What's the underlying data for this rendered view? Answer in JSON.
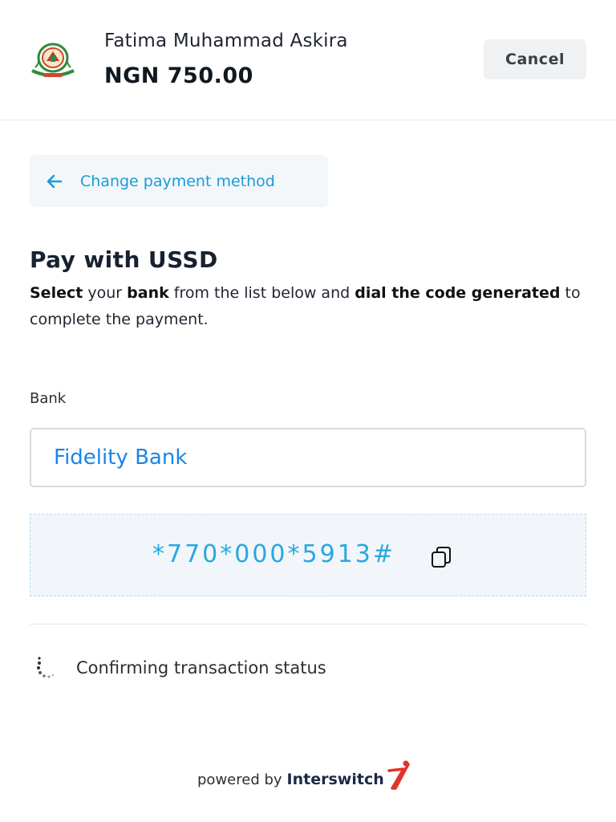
{
  "header": {
    "merchant_name": "Fatima Muhammad Askira",
    "amount": "NGN 750.00",
    "cancel_label": "Cancel"
  },
  "nav": {
    "change_method_label": "Change payment method",
    "back_icon": "arrow-left-icon"
  },
  "main": {
    "title": "Pay with USSD",
    "instruction_parts": [
      "Select",
      " your ",
      "bank",
      " from the list below and ",
      "dial the code generated",
      " to complete the payment."
    ]
  },
  "bank": {
    "label": "Bank",
    "selected": "Fidelity Bank"
  },
  "ussd": {
    "code": "*770*000*5913#",
    "copy_icon": "copy-icon"
  },
  "status": {
    "text": "Confirming transaction status",
    "icon": "loading-spinner-icon"
  },
  "footer": {
    "powered_by": "powered by",
    "brand": "Interswitch"
  },
  "colors": {
    "accent_blue": "#1a9bd7",
    "select_blue": "#1985e6",
    "brand_red": "#e4312b",
    "brand_navy": "#1b2a4a"
  }
}
